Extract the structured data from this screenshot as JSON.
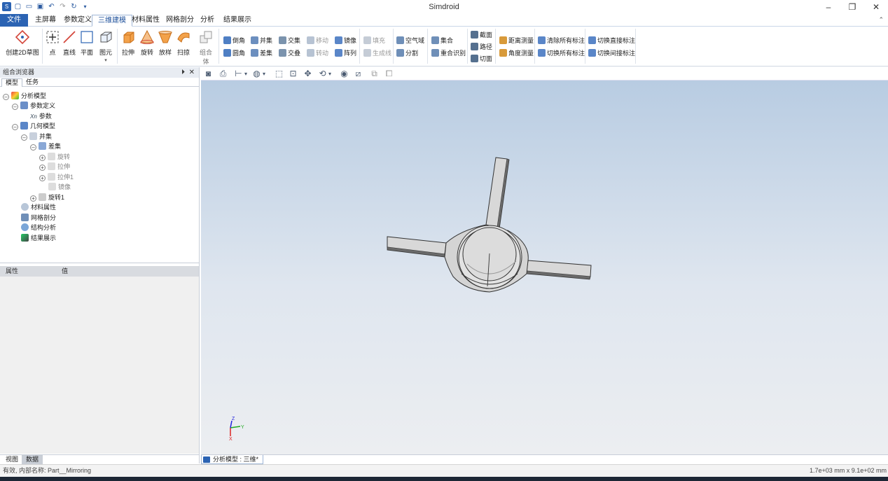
{
  "app": {
    "title": "Simdroid",
    "window_controls": [
      "–",
      "❐",
      "✕"
    ]
  },
  "ribbon_tabs": [
    {
      "label": "文件"
    },
    {
      "label": "主屏幕"
    },
    {
      "label": "参数定义"
    },
    {
      "label": "三维建模"
    },
    {
      "label": "材料属性"
    },
    {
      "label": "网格剖分"
    },
    {
      "label": "分析"
    },
    {
      "label": "结果展示"
    }
  ],
  "ribbon": {
    "big": [
      {
        "label": "创建2D草图",
        "icon": "sketch-icon"
      },
      {
        "label": "点",
        "icon": "point-icon"
      },
      {
        "label": "直线",
        "icon": "line-icon"
      },
      {
        "label": "平面",
        "icon": "plane-icon"
      },
      {
        "label": "图元",
        "icon": "primitive-icon"
      },
      {
        "label": "拉伸",
        "icon": "extrude-icon"
      },
      {
        "label": "旋转",
        "icon": "revolve-icon"
      },
      {
        "label": "放样",
        "icon": "loft-icon"
      },
      {
        "label": "扫掠",
        "icon": "sweep-icon"
      },
      {
        "label": "组合体",
        "icon": "assembly-icon"
      }
    ],
    "small": [
      {
        "label": "倒角",
        "icon": "chamfer-icon"
      },
      {
        "label": "圆角",
        "icon": "fillet-icon"
      },
      {
        "label": "并集",
        "icon": "union-icon"
      },
      {
        "label": "差集",
        "icon": "subtract-icon"
      },
      {
        "label": "交集",
        "icon": "intersect-icon"
      },
      {
        "label": "交叠",
        "icon": "overlap-icon"
      },
      {
        "label": "移动",
        "icon": "move-icon"
      },
      {
        "label": "转动",
        "icon": "rotate-icon"
      },
      {
        "label": "镜像",
        "icon": "mirror-icon"
      },
      {
        "label": "阵列",
        "icon": "pattern-icon"
      },
      {
        "label": "填充",
        "icon": "fill-icon"
      },
      {
        "label": "生成线",
        "icon": "generate-line-icon"
      },
      {
        "label": "空气域",
        "icon": "air-domain-icon"
      },
      {
        "label": "分割",
        "icon": "split-icon"
      },
      {
        "label": "集合",
        "icon": "set-icon"
      },
      {
        "label": "重合识别",
        "icon": "coincide-icon"
      },
      {
        "label": "截面",
        "icon": "section-icon"
      },
      {
        "label": "路径",
        "icon": "path-icon"
      },
      {
        "label": "切面",
        "icon": "cut-plane-icon"
      },
      {
        "label": "距离测量",
        "icon": "distance-icon"
      },
      {
        "label": "角度测量",
        "icon": "angle-icon"
      },
      {
        "label": "清除所有标注",
        "icon": "clear-annotations-icon"
      },
      {
        "label": "切换所有标注",
        "icon": "toggle-annotations-icon"
      },
      {
        "label": "切换直接标注",
        "icon": "toggle-direct-icon"
      },
      {
        "label": "切换间接标注",
        "icon": "toggle-indirect-icon"
      }
    ]
  },
  "browser": {
    "title": "组合浏览器",
    "tabs": [
      "模型",
      "任务"
    ],
    "tree": [
      {
        "label": "分析模型",
        "icon": "analysis-model-icon"
      },
      {
        "label": "参数定义",
        "icon": "param-def-icon"
      },
      {
        "label": "参数",
        "icon": "param-icon"
      },
      {
        "label": "几何模型",
        "icon": "geometry-icon"
      },
      {
        "label": "并集",
        "icon": "union-icon"
      },
      {
        "label": "差集",
        "icon": "subtract-icon"
      },
      {
        "label": "旋转",
        "icon": "revolve-icon"
      },
      {
        "label": "拉伸",
        "icon": "extrude-icon"
      },
      {
        "label": "拉伸1",
        "icon": "extrude-icon"
      },
      {
        "label": "镜像",
        "icon": "mirror-icon"
      },
      {
        "label": "旋转1",
        "icon": "revolve-icon"
      },
      {
        "label": "材料属性",
        "icon": "material-icon"
      },
      {
        "label": "网格剖分",
        "icon": "mesh-icon"
      },
      {
        "label": "结构分析",
        "icon": "structure-icon"
      },
      {
        "label": "结果展示",
        "icon": "result-icon"
      }
    ]
  },
  "properties": {
    "col_property": "属性",
    "col_value": "值"
  },
  "left_bottom_tabs": [
    "视图",
    "数据"
  ],
  "document_tab": "分析模型 : 三维*",
  "status": {
    "left": "有效, 内部名称: Part__Mirroring",
    "right": "1.7e+03 mm x 9.1e+02 mm"
  },
  "axis_labels": {
    "x": "X",
    "y": "Y",
    "z": "Z"
  }
}
